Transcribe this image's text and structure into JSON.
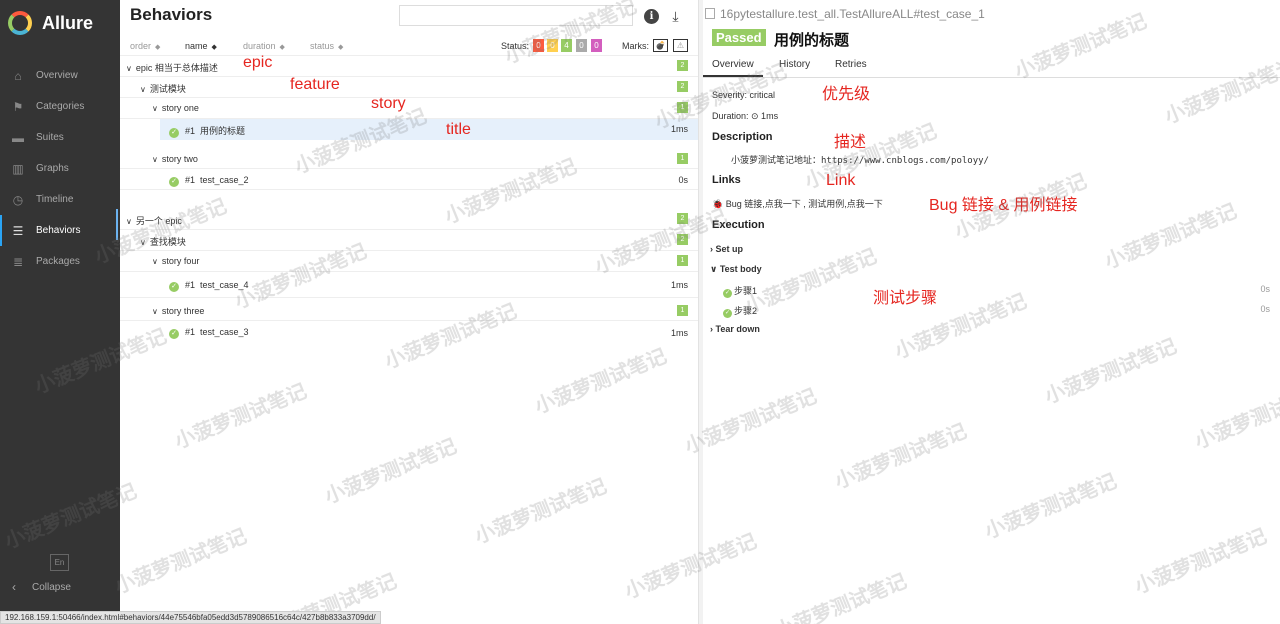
{
  "app": {
    "name": "Allure",
    "lang": "En",
    "collapse_label": "Collapse"
  },
  "sidebar": {
    "items": [
      {
        "label": "Overview",
        "icon": "home-icon",
        "glyph": "⌂",
        "active": false
      },
      {
        "label": "Categories",
        "icon": "flag-icon",
        "glyph": "⚑",
        "active": false
      },
      {
        "label": "Suites",
        "icon": "briefcase-icon",
        "glyph": "▬",
        "active": false
      },
      {
        "label": "Graphs",
        "icon": "bar-chart-icon",
        "glyph": "▥",
        "active": false
      },
      {
        "label": "Timeline",
        "icon": "clock-icon",
        "glyph": "◷",
        "active": false
      },
      {
        "label": "Behaviors",
        "icon": "list-icon",
        "glyph": "☰",
        "active": true
      },
      {
        "label": "Packages",
        "icon": "stack-icon",
        "glyph": "≣",
        "active": false
      }
    ]
  },
  "behaviors": {
    "title": "Behaviors",
    "sort": {
      "order": "order",
      "name": "name",
      "duration": "duration",
      "status": "status"
    },
    "status_label": "Status:",
    "status_counts": [
      {
        "value": "0",
        "color": "#fd5a3e"
      },
      {
        "value": "0",
        "color": "#ffd050"
      },
      {
        "value": "4",
        "color": "#97cc64"
      },
      {
        "value": "0",
        "color": "#aaaaaa"
      },
      {
        "value": "0",
        "color": "#d35ebe"
      }
    ],
    "marks_label": "Marks:",
    "tree": {
      "epic1": {
        "label": "epic 相当于总体描述",
        "count": "2"
      },
      "feature1": {
        "label": "测试模块",
        "count": "2"
      },
      "story_one": {
        "label": "story one",
        "count": "1"
      },
      "case1": {
        "num": "#1",
        "name": "用例的标题",
        "duration": "1ms"
      },
      "story_two": {
        "label": "story two",
        "count": "1"
      },
      "case2": {
        "num": "#1",
        "name": "test_case_2",
        "duration": "0s"
      },
      "epic2": {
        "label": "另一个 epic",
        "count": "2"
      },
      "feature2": {
        "label": "查找模块",
        "count": "2"
      },
      "story_four": {
        "label": "story four",
        "count": "1"
      },
      "case4": {
        "num": "#1",
        "name": "test_case_4",
        "duration": "1ms"
      },
      "story_three": {
        "label": "story three",
        "count": "1"
      },
      "case3": {
        "num": "#1",
        "name": "test_case_3",
        "duration": "1ms"
      }
    }
  },
  "detail": {
    "breadcrumb": "16pytestallure.test_all.TestAllureALL#test_case_1",
    "status_badge": "Passed",
    "title": "用例的标题",
    "tabs": [
      "Overview",
      "History",
      "Retries"
    ],
    "severity": "Severity: critical",
    "duration": "Duration: ⊙ 1ms",
    "description_heading": "Description",
    "description_text": "小菠萝测试笔记地址：https://www.cnblogs.com/poloyy/",
    "links_heading": "Links",
    "links_text": "Bug 链接,点我一下 , 测试用例,点我一下",
    "execution_heading": "Execution",
    "setup": "Set up",
    "test_body": "Test body",
    "steps": [
      {
        "name": "步骤1",
        "duration": "0s"
      },
      {
        "name": "步骤2",
        "duration": "0s"
      }
    ],
    "teardown": "Tear down"
  },
  "annotations": {
    "epic": "epic",
    "feature": "feature",
    "story": "story",
    "title": "title",
    "priority": "优先级",
    "describe": "描述",
    "link": "Link",
    "bug_link": "Bug 链接 & 用例链接",
    "steps": "测试步骤"
  },
  "watermark": "小菠萝测试笔记",
  "status_bar": "192.168.159.1:50466/index.html#behaviors/44e75546bfa05edd3d5789086516c64c/427b8b833a3709dd/"
}
